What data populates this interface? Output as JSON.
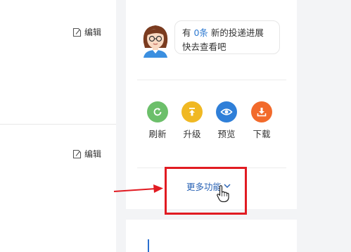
{
  "left_panel": {
    "edit_links": [
      {
        "label": "编辑",
        "icon": "edit-icon"
      },
      {
        "label": "编辑",
        "icon": "edit-icon"
      }
    ]
  },
  "notice": {
    "prefix": "有 ",
    "count": "0条",
    "suffix": " 新的投递进展快去查看吧",
    "avatar_icon": "avatar-icon"
  },
  "actions": [
    {
      "label": "刷新",
      "icon": "refresh-icon",
      "color": "#6cbf6a"
    },
    {
      "label": "升级",
      "icon": "upgrade-icon",
      "color": "#f0b823"
    },
    {
      "label": "预览",
      "icon": "preview-icon",
      "color": "#2f7fd8"
    },
    {
      "label": "下载",
      "icon": "download-icon",
      "color": "#f26a2b"
    }
  ],
  "more": {
    "label": "更多功能",
    "icon": "chevron-down-icon"
  },
  "annotation": {
    "highlight_color": "#e11b22",
    "arrow_icon": "arrow-right-icon",
    "cursor_icon": "hand-cursor-icon"
  }
}
